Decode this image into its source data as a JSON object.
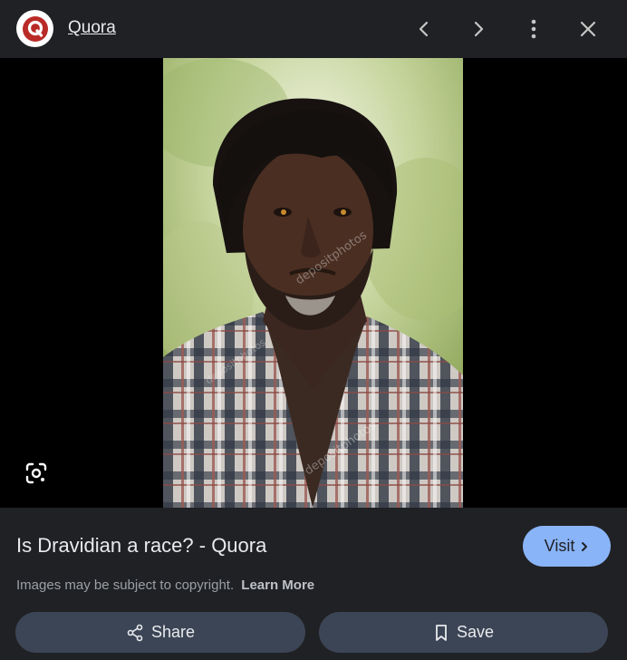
{
  "header": {
    "site_name": "Quora",
    "logo_letter": "Q"
  },
  "result": {
    "title": "Is Dravidian a race? - Quora",
    "visit_label": "Visit",
    "copyright_text": "Images may be subject to copyright.",
    "learn_more_label": "Learn More"
  },
  "actions": {
    "share_label": "Share",
    "save_label": "Save"
  },
  "image": {
    "watermark": "depositphotos"
  },
  "colors": {
    "background": "#202124",
    "viewer_bg": "#000000",
    "visit_button": "#8ab4f8",
    "action_button": "#3c4555",
    "quora_red": "#b92b27"
  },
  "icons": [
    "quora-logo-icon",
    "chevron-left-icon",
    "chevron-right-icon",
    "more-vert-icon",
    "close-icon",
    "lens-icon",
    "chevron-right-small-icon",
    "share-icon",
    "bookmark-icon"
  ]
}
